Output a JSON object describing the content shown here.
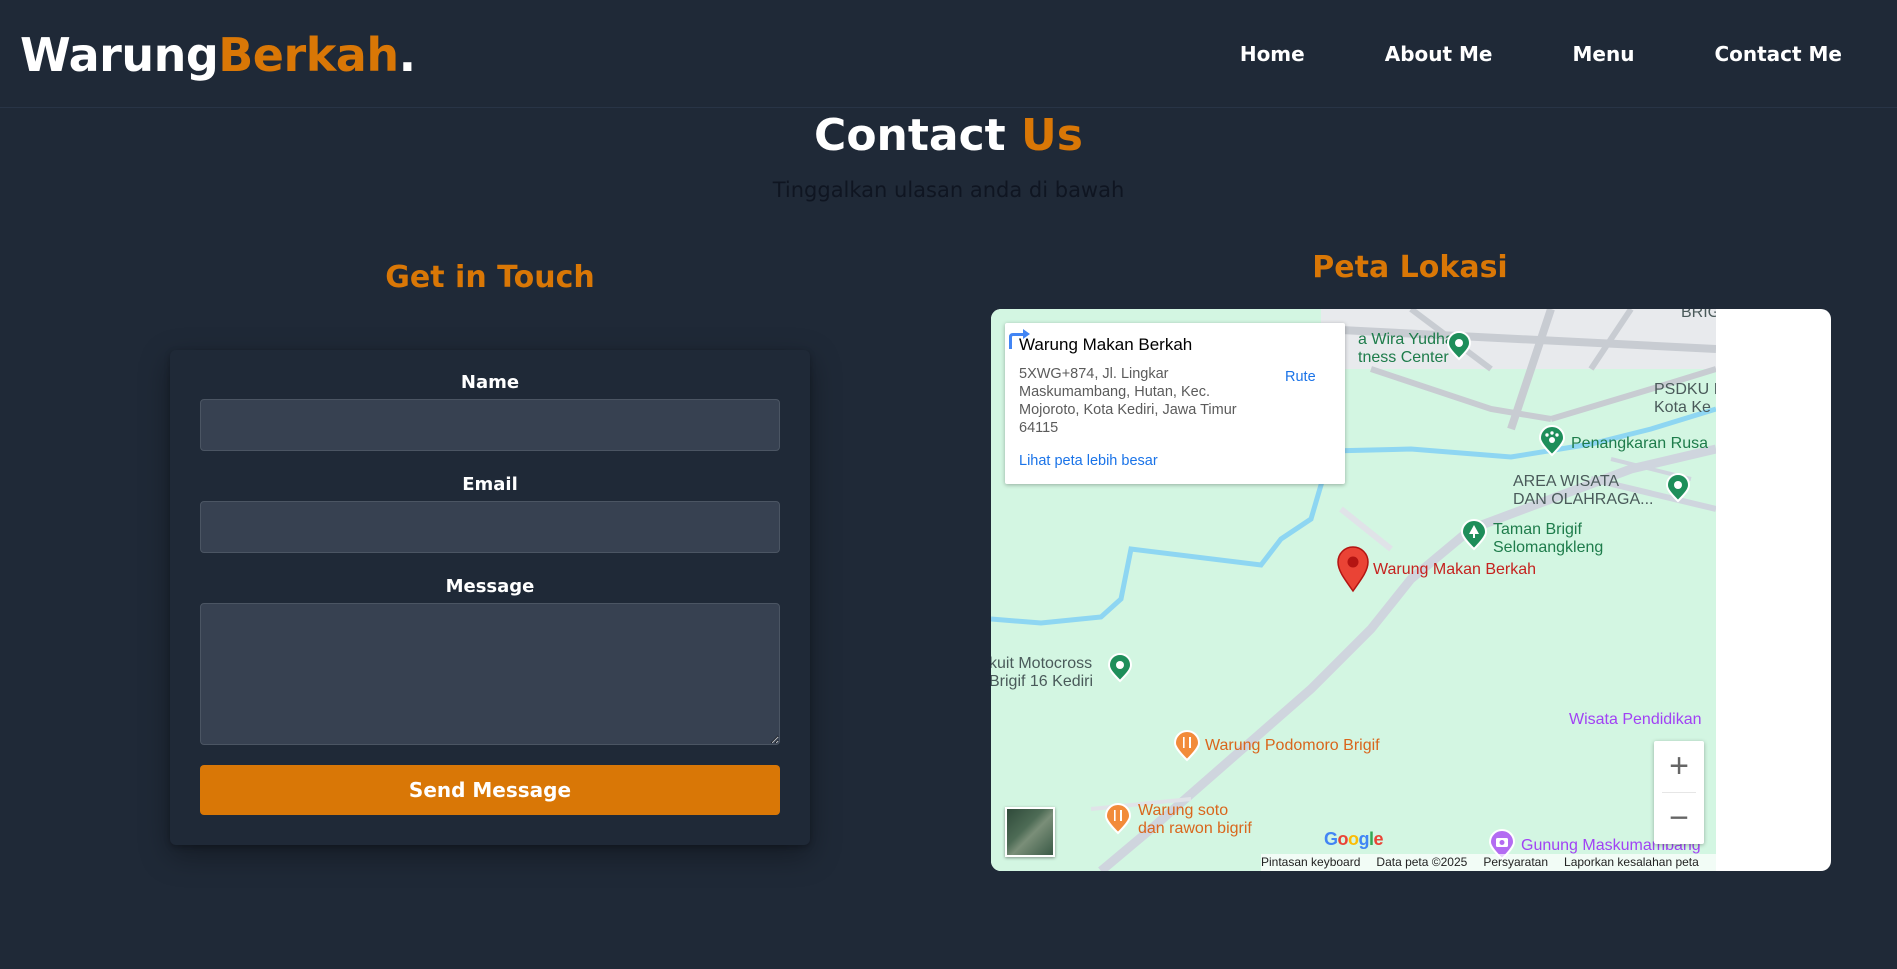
{
  "brand": {
    "part1": "Warung",
    "part2": "Berkah",
    "dot": "."
  },
  "nav": {
    "items": [
      "Home",
      "About Me",
      "Menu",
      "Contact Me"
    ]
  },
  "header": {
    "title_main": "Contact",
    "title_accent": "Us",
    "subtitle": "Tinggalkan ulasan anda di bawah"
  },
  "contact": {
    "heading": "Get in Touch",
    "fields": {
      "name_label": "Name",
      "email_label": "Email",
      "message_label": "Message"
    },
    "submit_label": "Send Message"
  },
  "map": {
    "heading": "Peta Lokasi",
    "info": {
      "name": "Warung Makan Berkah",
      "address": "5XWG+874, Jl. Lingkar Maskumambang, Hutan, Kec. Mojoroto, Kota Kediri, Jawa Timur 64115",
      "route_label": "Rute",
      "larger_map_link": "Lihat peta lebih besar"
    },
    "pois": {
      "wira_yudha_1": "a Wira Yudha",
      "wira_yudha_2": "tness Center",
      "brig": "BRIG",
      "psdku_1": "PSDKU I",
      "psdku_2": "Kota Ke",
      "penangkaran": "Penangkaran Rusa",
      "area_wisata_1": "AREA WISATA",
      "area_wisata_2": "DAN OLAHRAGA...",
      "taman_1": "Taman Brigif",
      "taman_2": "Selomangkleng",
      "warung_berkah": "Warung Makan Berkah",
      "motocross_1": "kuit Motocross",
      "motocross_2": "Brigif 16 Kediri",
      "wisata_pendidikan": "Wisata Pendidikan",
      "podomoro": "Warung Podomoro Brigif",
      "soto_1": "Warung soto",
      "soto_2": "dan rawon bigrif",
      "gunung": "Gunung Maskumambang"
    },
    "zoom_in": "+",
    "zoom_out": "−",
    "google_logo": "Google",
    "attribution": [
      "Pintasan keyboard",
      "Data peta ©2025",
      "Persyaratan",
      "Laporkan kesalahan peta"
    ],
    "icons": {
      "route": "directions-icon",
      "pin": "location-pin-icon",
      "park": "tree-icon",
      "restaurant": "fork-knife-icon",
      "paw": "paw-icon",
      "camera": "camera-icon"
    }
  },
  "colors": {
    "background": "#1f2937",
    "accent": "#d97706",
    "input": "#374151",
    "map_bg": "#d3f6e2"
  }
}
